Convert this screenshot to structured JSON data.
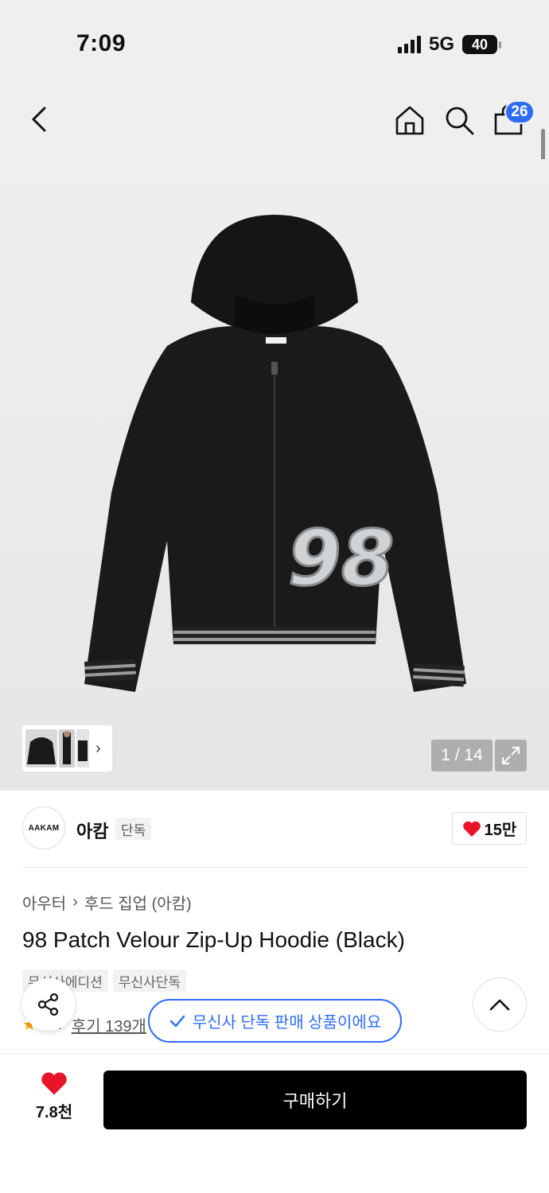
{
  "status_bar": {
    "time": "7:09",
    "network": "5G",
    "battery": "40"
  },
  "nav": {
    "cart_count": "26"
  },
  "gallery": {
    "counter": "1 / 14"
  },
  "brand": {
    "logo_text": "AAKAM",
    "name": "아캄",
    "tag": "단독",
    "likes": "15만"
  },
  "product": {
    "breadcrumb": [
      "아우터",
      "후드 집업 (아캄)"
    ],
    "title": "98 Patch Velour Zip-Up Hoodie (Black)",
    "tags": [
      "무신사에디션",
      "무신사단독"
    ],
    "rating": "4.7",
    "reviews": "후기 139개"
  },
  "toast": {
    "text": "무신사 단독 판매 상품이에요"
  },
  "bottom_bar": {
    "favorite_count": "7.8천",
    "buy_label": "구매하기"
  },
  "colors": {
    "accent": "#2f6cf6",
    "like": "#e8142a",
    "buy_button": "#000000"
  }
}
